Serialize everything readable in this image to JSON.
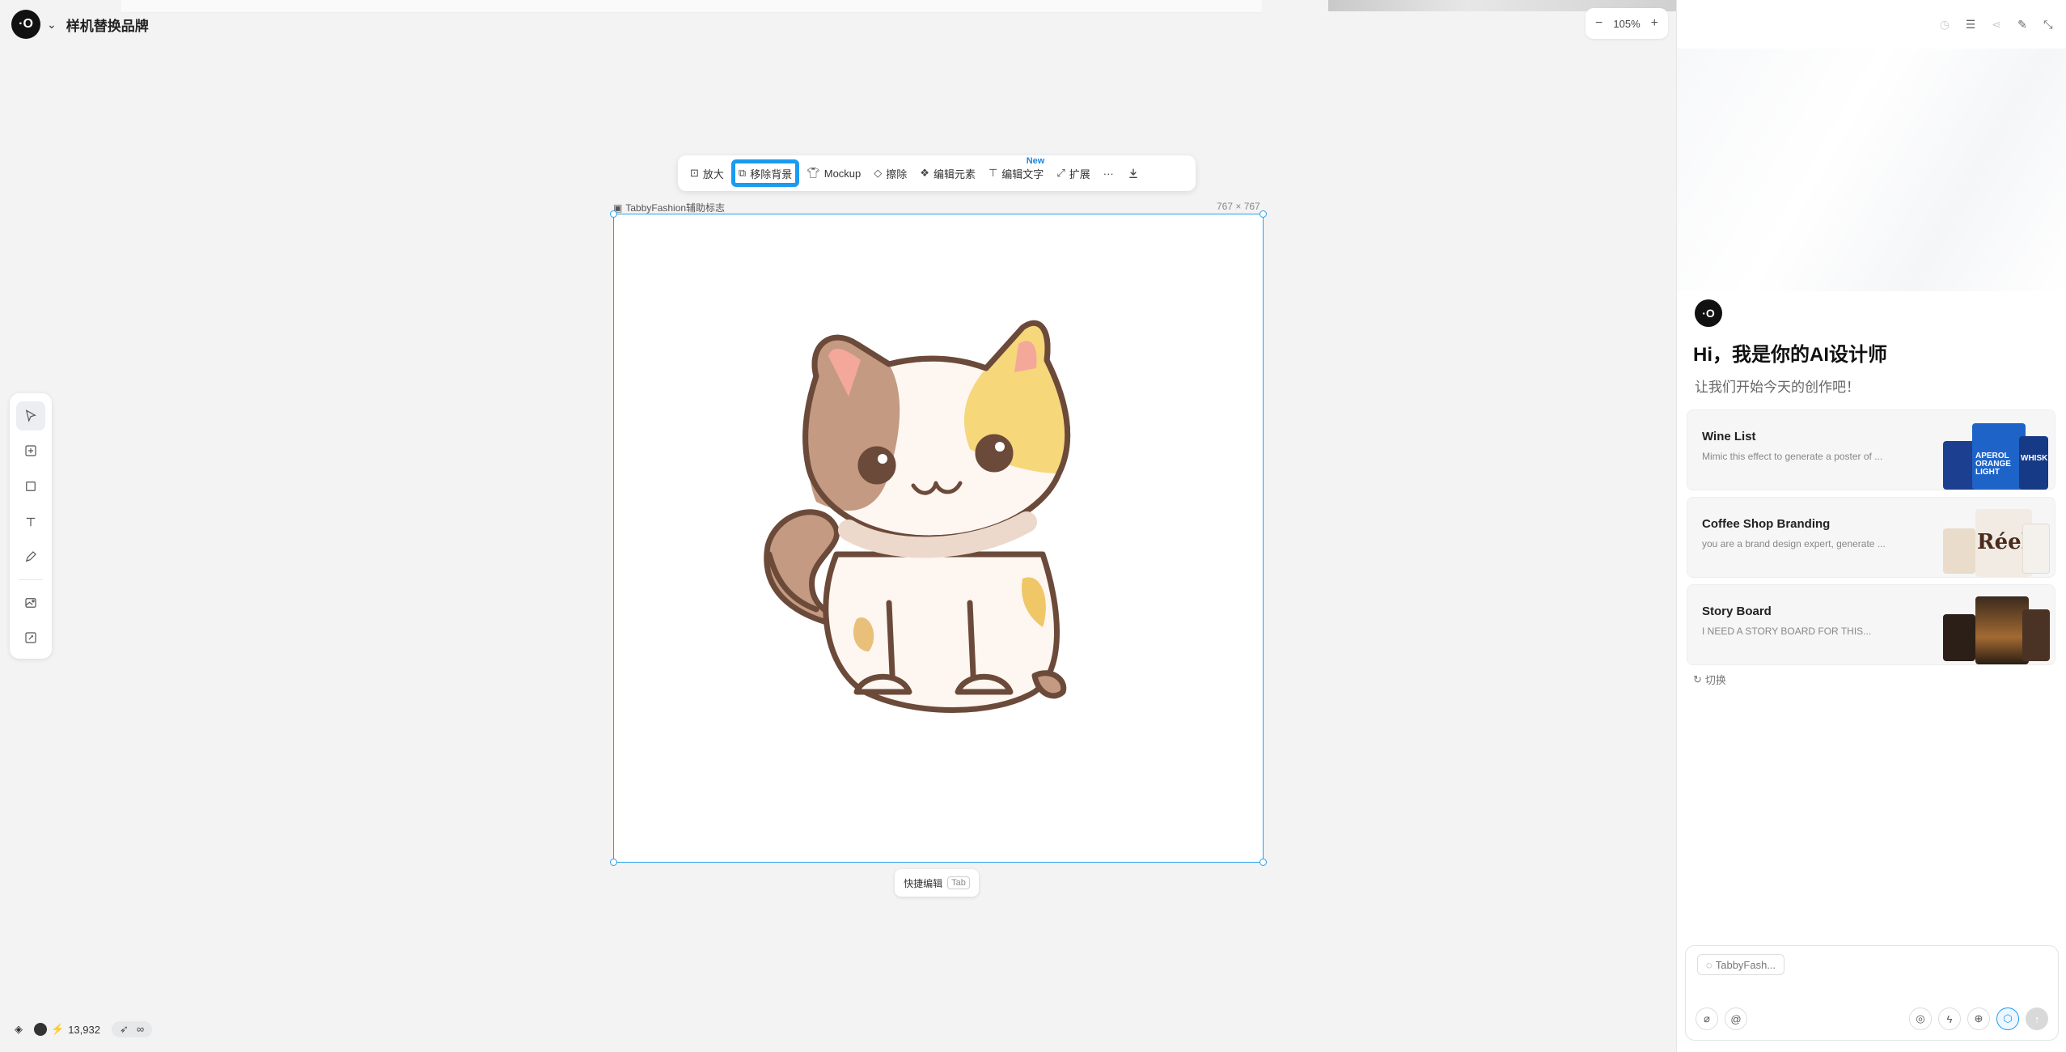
{
  "header": {
    "logo_glyph": "·O",
    "project_title": "样机替换品牌",
    "dropdown_icon": "chevron-down-icon"
  },
  "zoom": {
    "minus": "−",
    "level": "105%",
    "plus": "+"
  },
  "tools": [
    {
      "name": "select-tool",
      "icon": "cursor-icon"
    },
    {
      "name": "add-tool",
      "icon": "plus-square-icon"
    },
    {
      "name": "frame-tool",
      "icon": "square-icon"
    },
    {
      "name": "text-tool",
      "icon": "text-icon"
    },
    {
      "name": "pen-tool",
      "icon": "pen-icon"
    },
    {
      "name": "image-gen-tool",
      "icon": "image-sparkle-icon"
    },
    {
      "name": "image-edit-tool",
      "icon": "image-edit-icon"
    }
  ],
  "toolbar": {
    "upscale": "放大",
    "remove_bg": "移除背景",
    "mockup": "Mockup",
    "erase": "擦除",
    "edit_elements": "编辑元素",
    "edit_text": "编辑文字",
    "new_badge": "New",
    "expand": "扩展",
    "more": "···",
    "download_icon": "download-icon"
  },
  "frame": {
    "label": "TabbyFashion辅助标志",
    "size": "767 × 767"
  },
  "quick_edit": {
    "label": "快捷编辑",
    "key": "Tab"
  },
  "bottom": {
    "credits": "13,932",
    "bolt": "⚡",
    "infinity": "∞"
  },
  "panel": {
    "greeting": "Hi，我是你的AI设计师",
    "sub_greeting": "让我们开始今天的创作吧！",
    "cards": [
      {
        "title": "Wine List",
        "desc": "Mimic this effect to generate a poster of ..."
      },
      {
        "title": "Coffee Shop Branding",
        "desc": "you are a brand design expert, generate ..."
      },
      {
        "title": "Story Board",
        "desc": "I NEED A STORY BOARD FOR THIS..."
      }
    ],
    "thumb_texts": {
      "aperol": "APEROL ORANGE LIGHT",
      "whiskey": "WHISKEY",
      "reel": "Réel"
    },
    "switch_label": "切换",
    "composer_chip": "TabbyFash...",
    "colors": {
      "accent": "#1a9bf0",
      "selection": "#29a1ef"
    }
  }
}
